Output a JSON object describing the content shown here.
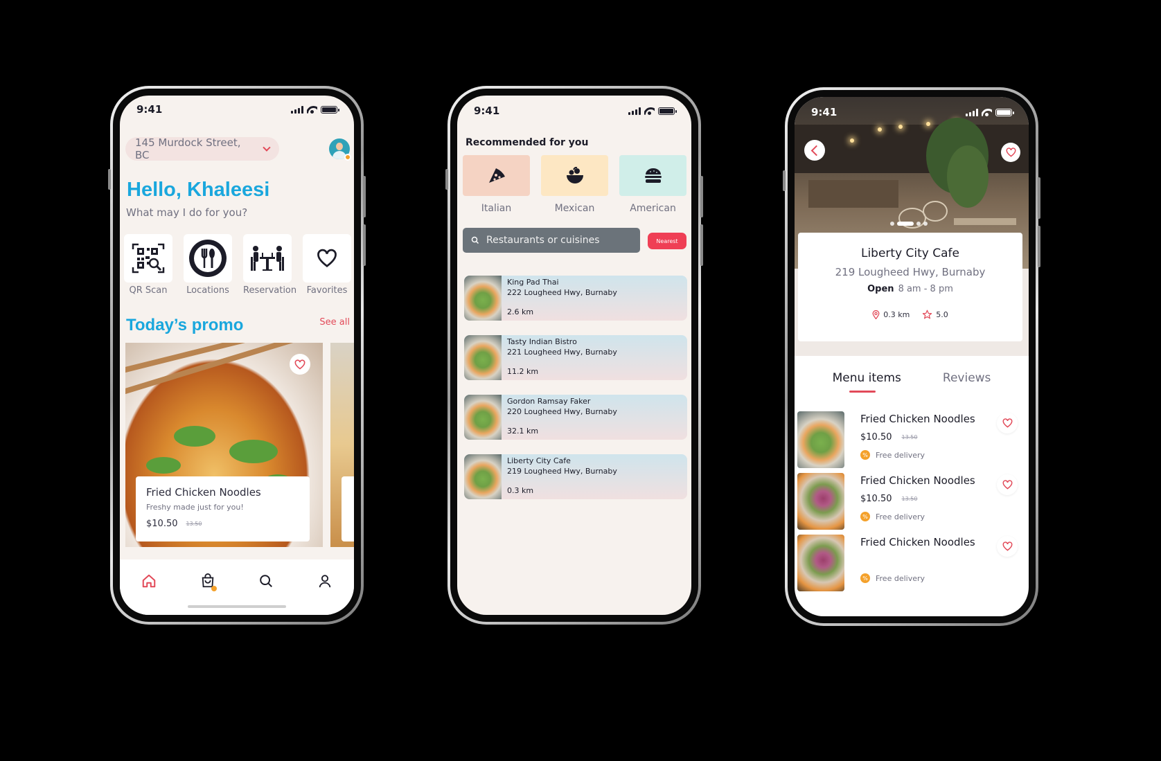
{
  "status": {
    "time": "9:41"
  },
  "home": {
    "address": "145 Murdock Street, BC",
    "greeting": "Hello, Khaleesi",
    "subtitle": "What may I do for you?",
    "actions": [
      {
        "label": "QR Scan",
        "icon": "qr-scan-icon"
      },
      {
        "label": "Locations",
        "icon": "fork-spoon-icon"
      },
      {
        "label": "Reservation",
        "icon": "dining-table-icon"
      },
      {
        "label": "Favorites",
        "icon": "heart-icon"
      }
    ],
    "promo_title": "Today’s promo",
    "see_all": "See all",
    "promo": {
      "title": "Fried Chicken Noodles",
      "subtitle": "Freshy made just for you!",
      "price": "$10.50",
      "old_price": "13.50"
    },
    "tabbar": [
      "home-icon",
      "cart-icon",
      "search-icon",
      "profile-icon"
    ]
  },
  "search_screen": {
    "recommended_title": "Recommended for you",
    "cuisines": [
      {
        "name": "Italian",
        "icon": "pizza-icon",
        "color": "#f5d3c3"
      },
      {
        "name": "Mexican",
        "icon": "salad-bowl-icon",
        "color": "#fde7c3"
      },
      {
        "name": "American",
        "icon": "burger-icon",
        "color": "#d0eee9"
      }
    ],
    "search_placeholder": "Restaurants or cuisines",
    "sort_label": "Nearest",
    "restaurants": [
      {
        "name": "King Pad Thai",
        "address": "222 Lougheed Hwy, Burnaby",
        "distance": "2.6 km"
      },
      {
        "name": "Tasty Indian Bistro",
        "address": "221 Lougheed Hwy, Burnaby",
        "distance": "11.2 km"
      },
      {
        "name": "Gordon Ramsay Faker",
        "address": "220 Lougheed Hwy, Burnaby",
        "distance": "32.1 km"
      },
      {
        "name": "Liberty City Cafe",
        "address": "219 Lougheed Hwy, Burnaby",
        "distance": "0.3 km"
      }
    ]
  },
  "detail": {
    "name": "Liberty City Cafe",
    "address": "219 Lougheed Hwy, Burnaby",
    "open_label": "Open",
    "hours": "8 am - 8 pm",
    "distance": "0.3 km",
    "rating": "5.0",
    "tabs": [
      "Menu items",
      "Reviews"
    ],
    "menu": [
      {
        "name": "Fried Chicken Noodles",
        "price": "$10.50",
        "old_price": "13.50",
        "delivery": "Free delivery"
      },
      {
        "name": "Fried Chicken Noodles",
        "price": "$10.50",
        "old_price": "13.50",
        "delivery": "Free delivery"
      },
      {
        "name": "Fried Chicken Noodles",
        "price": "",
        "old_price": "",
        "delivery": "Free delivery"
      }
    ]
  },
  "colors": {
    "accent_blue": "#1aa7dd",
    "accent_red": "#e24a59",
    "orange": "#f4a12b",
    "screen_bg": "#f7f2ee"
  }
}
